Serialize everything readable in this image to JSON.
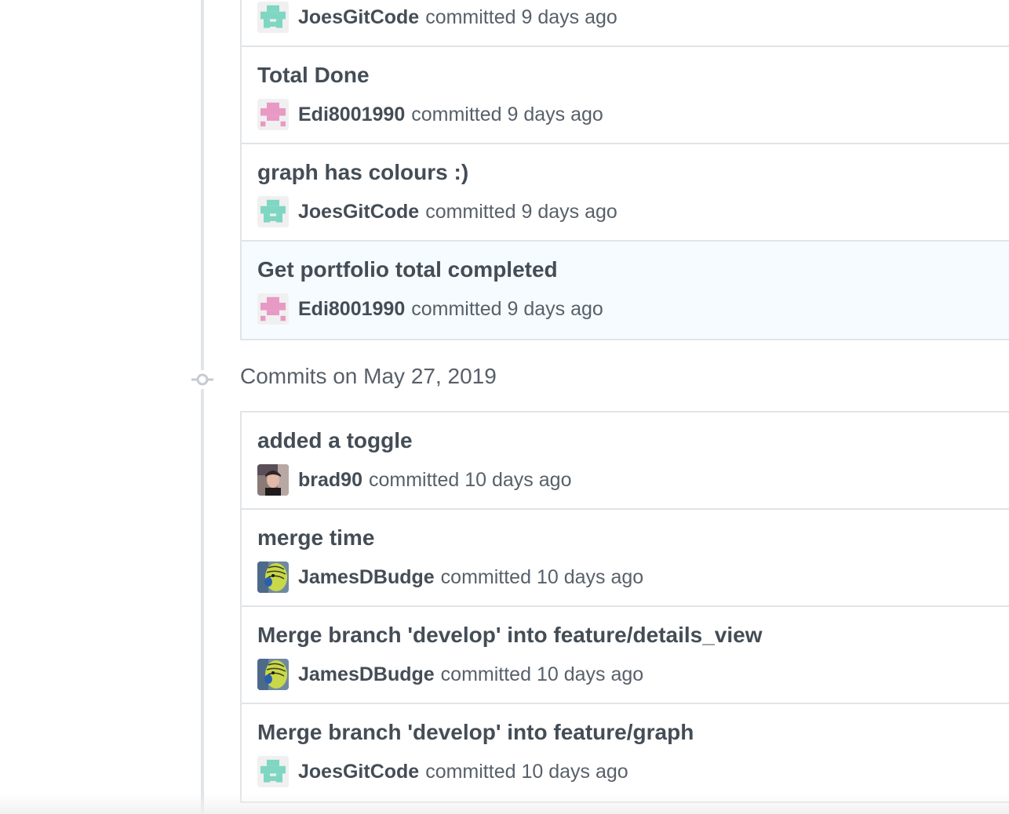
{
  "colors": {
    "identicon_teal": "#7fd6c2",
    "identicon_pink": "#e89ac4",
    "border": "#e1e4e8",
    "highlight_bg": "#f6fbff"
  },
  "group_1": {
    "commits": [
      {
        "title": "",
        "author": "JoesGitCode",
        "verb": "committed",
        "time": "9 days ago",
        "avatar": "identicon-teal"
      },
      {
        "title": "Total Done",
        "author": "Edi8001990",
        "verb": "committed",
        "time": "9 days ago",
        "avatar": "identicon-pink"
      },
      {
        "title": "graph has colours :)",
        "author": "JoesGitCode",
        "verb": "committed",
        "time": "9 days ago",
        "avatar": "identicon-teal"
      },
      {
        "title": "Get portfolio total completed",
        "author": "Edi8001990",
        "verb": "committed",
        "time": "9 days ago",
        "avatar": "identicon-pink"
      }
    ]
  },
  "group_2": {
    "date_header": "Commits on May 27, 2019",
    "commits": [
      {
        "title": "added a toggle",
        "author": "brad90",
        "verb": "committed",
        "time": "10 days ago",
        "avatar": "photo-person"
      },
      {
        "title": "merge time",
        "author": "JamesDBudge",
        "verb": "committed",
        "time": "10 days ago",
        "avatar": "photo-budgie"
      },
      {
        "title": "Merge branch 'develop' into feature/details_view",
        "author": "JamesDBudge",
        "verb": "committed",
        "time": "10 days ago",
        "avatar": "photo-budgie"
      },
      {
        "title": "Merge branch 'develop' into feature/graph",
        "author": "JoesGitCode",
        "verb": "committed",
        "time": "10 days ago",
        "avatar": "identicon-teal"
      }
    ]
  }
}
